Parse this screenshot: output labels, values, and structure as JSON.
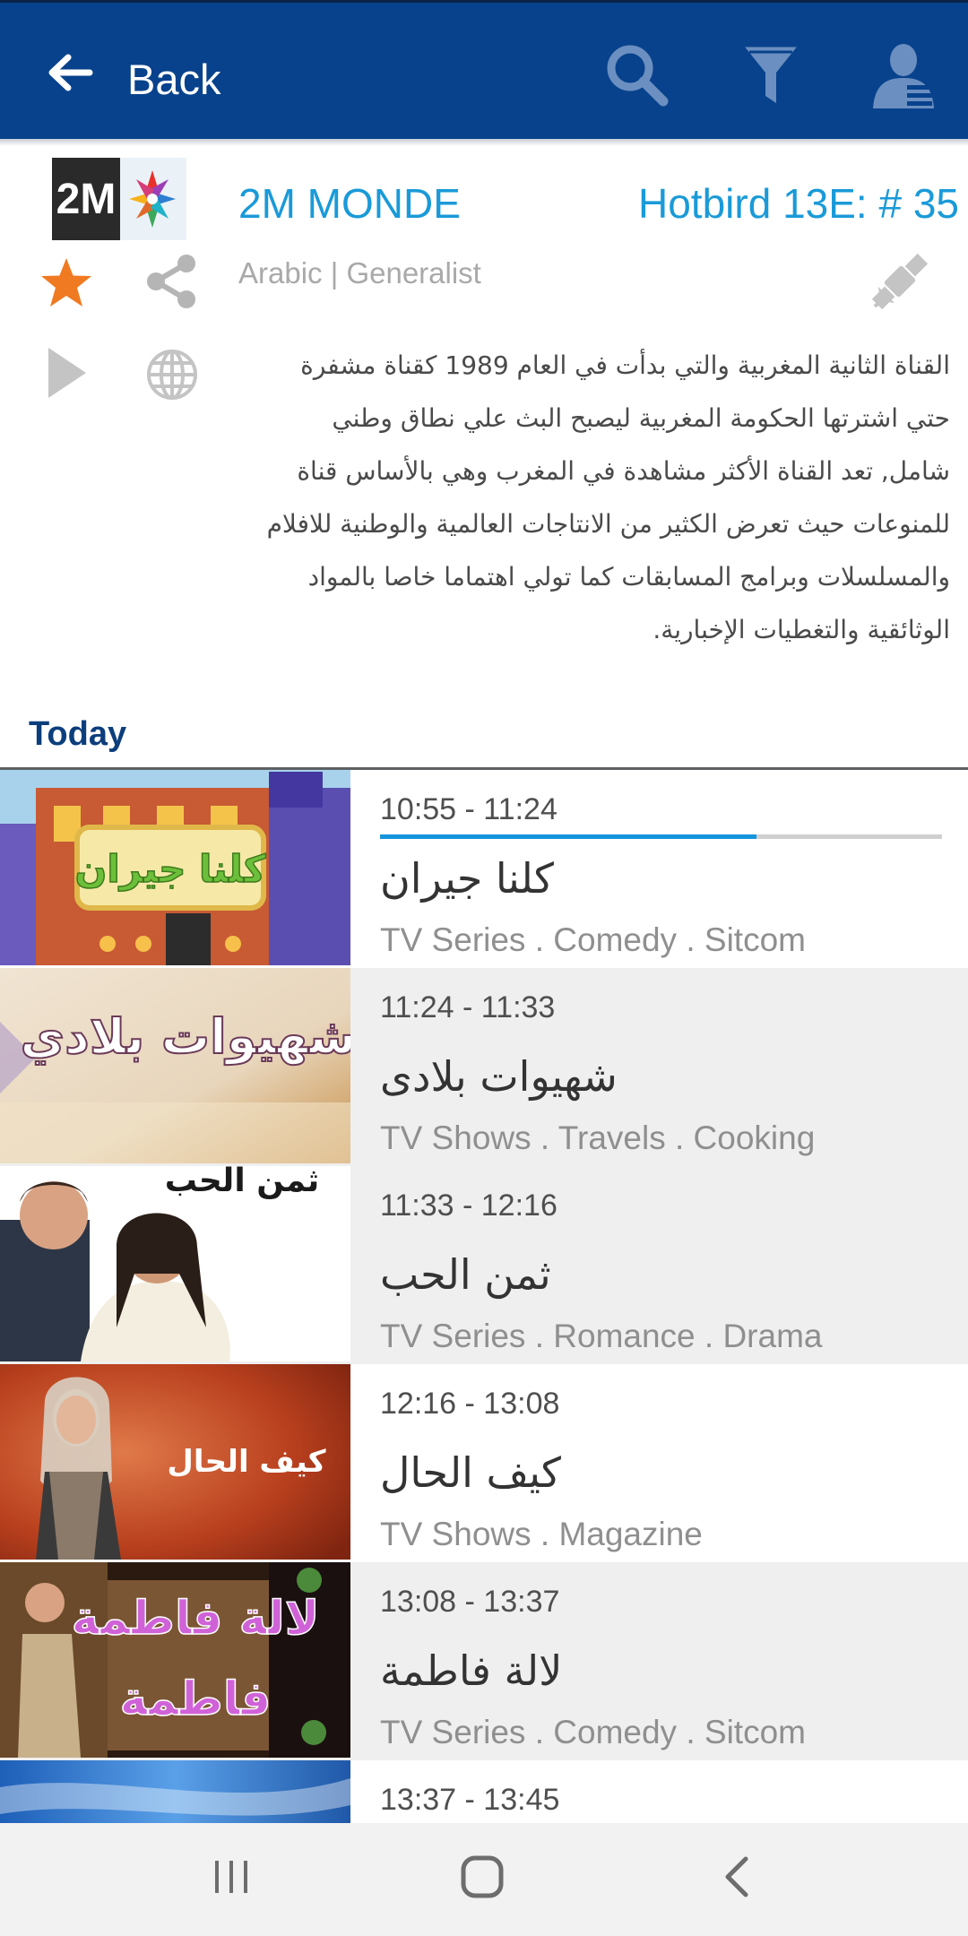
{
  "header": {
    "back_label": "Back",
    "icons": [
      "back-arrow-icon",
      "search-icon",
      "filter-icon",
      "profile-icon"
    ],
    "background": "#08428c"
  },
  "channel": {
    "logo_text": "2M",
    "name": "2M MONDE",
    "position": "Hotbird 13E: # 35",
    "meta": "Arabic | Generalist",
    "description": "القناة الثانية المغربية والتي بدأت في العام 1989 كقناة مشفرة حتي اشترتها الحكومة المغربية ليصبح البث علي نطاق وطني شامل, تعد القناة الأكثر مشاهدة في المغرب وهي بالأساس قناة للمنوعات حيث تعرض الكثير من الانتاجات العالمية والوطنية للافلام والمسلسلات وبرامج المسابقات كما تولي اهتماما خاصا بالمواد الوثائقية والتغطيات الإخبارية.",
    "favorite_color": "#f07a22",
    "accent": "#1a9ad8"
  },
  "schedule": {
    "section_label": "Today",
    "programs": [
      {
        "time": "10:55 - 11:24",
        "title": "كلنا جيران",
        "genre": "TV Series . Comedy . Sitcom",
        "progress": 0.67,
        "thumb_text": "كلنا جيران"
      },
      {
        "time": "11:24 - 11:33",
        "title": "شهيوات بلادى",
        "genre": "TV Shows . Travels . Cooking",
        "thumb_text": "شهيوات بلادي"
      },
      {
        "time": "11:33 - 12:16",
        "title": "ثمن الحب",
        "genre": "TV Series . Romance . Drama",
        "thumb_text": "ثمن الحب"
      },
      {
        "time": "12:16 - 13:08",
        "title": "كيف الحال",
        "genre": "TV Shows . Magazine",
        "thumb_text": "كيف الحال"
      },
      {
        "time": "13:08 - 13:37",
        "title": "لالة فاطمة",
        "genre": "TV Series . Comedy . Sitcom",
        "thumb_text": "لالة فاطمة"
      },
      {
        "time": "13:37 - 13:45"
      }
    ]
  },
  "navbar": {
    "icons": [
      "recent-apps-icon",
      "home-icon",
      "nav-back-icon"
    ]
  }
}
